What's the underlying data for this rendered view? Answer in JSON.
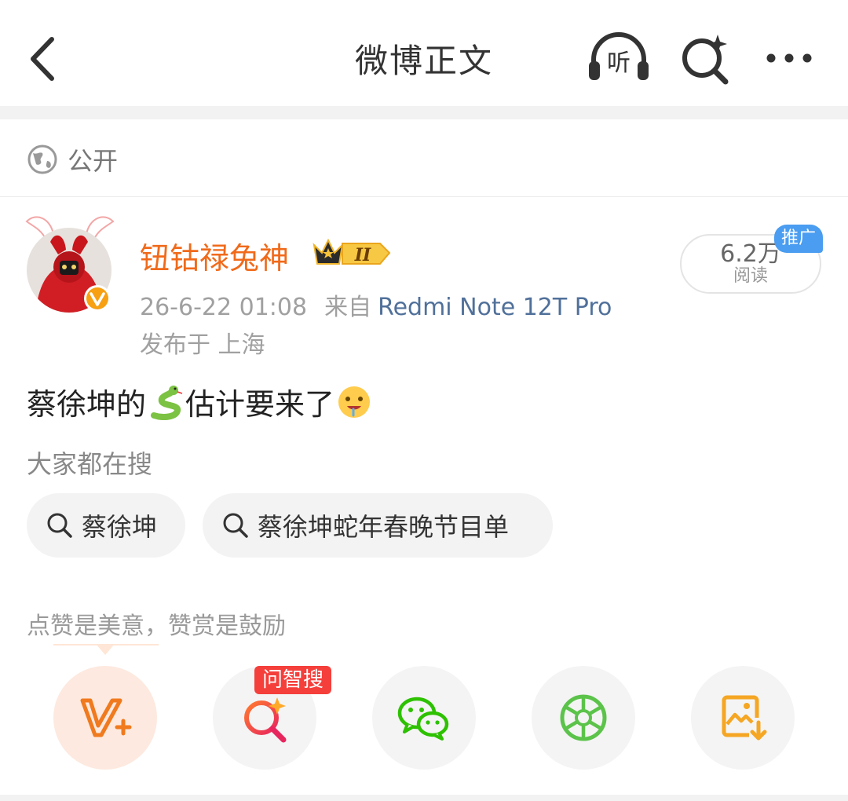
{
  "header": {
    "title": "微博正文",
    "listen_label": "听"
  },
  "post": {
    "visibility": "公开",
    "author": {
      "name": "钮钴禄兔神",
      "level_badge": "II",
      "verified": true
    },
    "time": "26-6-22 01:08",
    "source_prefix": "来自",
    "source_device": "Redmi Note 12T Pro",
    "location": "发布于 上海",
    "reads": {
      "count": "6.2万",
      "label": "阅读",
      "promo_badge": "推广"
    },
    "content": {
      "text_before": "蔡徐坤的",
      "emoji_1": "snake-emoji",
      "text_after": "估计要来了",
      "emoji_2": "drooling-face-emoji"
    }
  },
  "hot_search": {
    "title": "大家都在搜",
    "items": [
      {
        "label": "蔡徐坤"
      },
      {
        "label": "蔡徐坤蛇年春晚节目单"
      }
    ]
  },
  "encourage_text": "点赞是美意，赞赏是鼓励",
  "actions": {
    "items": [
      {
        "icon": "v-plus-icon"
      },
      {
        "icon": "ai-search-icon",
        "badge": "问智搜"
      },
      {
        "icon": "wechat-icon"
      },
      {
        "icon": "moments-icon"
      },
      {
        "icon": "save-image-icon"
      }
    ]
  },
  "colors": {
    "username": "#f06a1a",
    "device_link": "#50709a",
    "promo_badge": "#4a9df0",
    "ai_badge": "#f43f3b",
    "wechat_green": "#2dc100",
    "v_orange": "#f07a1e"
  }
}
